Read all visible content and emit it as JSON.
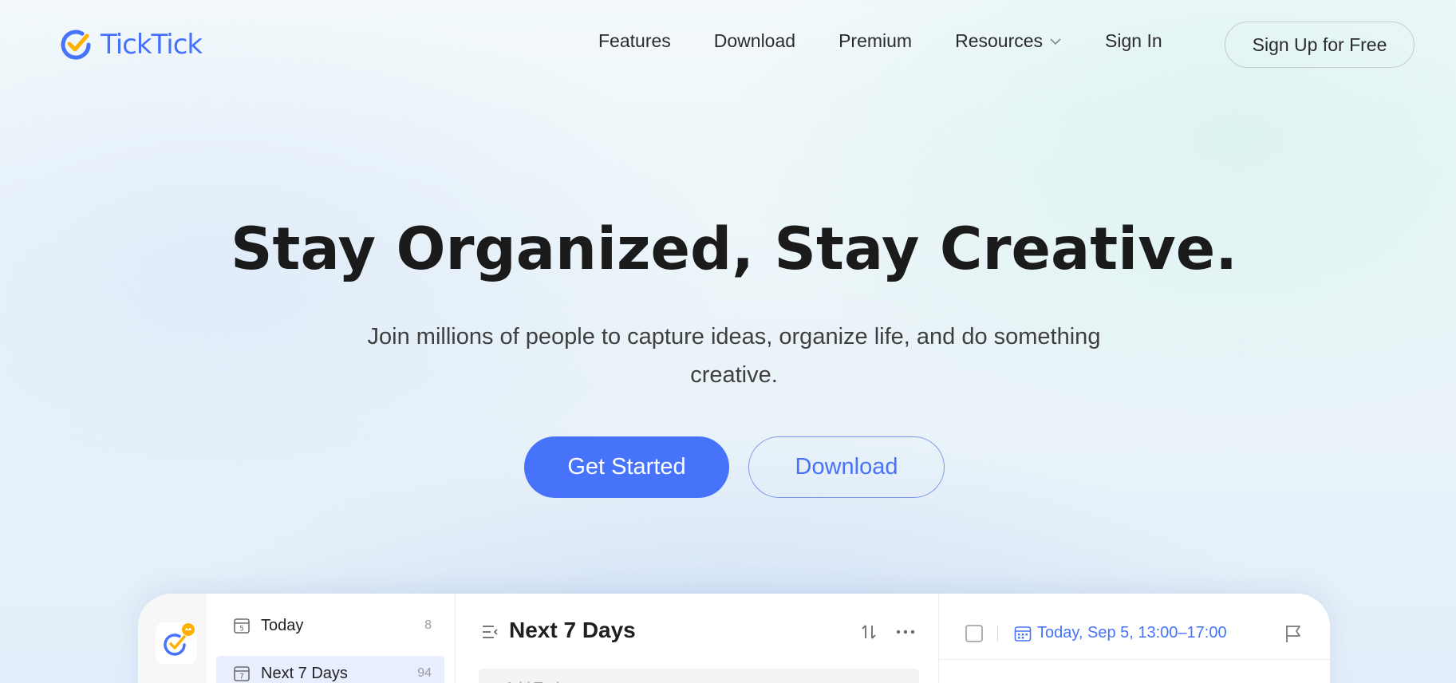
{
  "brand": {
    "name": "TickTick",
    "colors": {
      "primary": "#4772fa",
      "accent": "#ffb000"
    }
  },
  "nav": {
    "links": [
      "Features",
      "Download",
      "Premium",
      "Resources",
      "Sign In"
    ],
    "signup_label": "Sign Up for Free"
  },
  "hero": {
    "title": "Stay Organized, Stay Creative.",
    "subtitle": "Join millions of people to capture ideas, organize life, and do something creative.",
    "primary_cta": "Get Started",
    "secondary_cta": "Download"
  },
  "app_preview": {
    "lists": [
      {
        "label": "Today",
        "count": "8",
        "icon": "calendar-today-icon",
        "active": false
      },
      {
        "label": "Next 7 Days",
        "count": "94",
        "icon": "calendar-week-icon",
        "active": true
      }
    ],
    "main": {
      "title": "Next 7 Days",
      "add_task_placeholder": "+ Add Task"
    },
    "detail": {
      "date_text": "Today, Sep 5, 13:00–17:00"
    }
  }
}
